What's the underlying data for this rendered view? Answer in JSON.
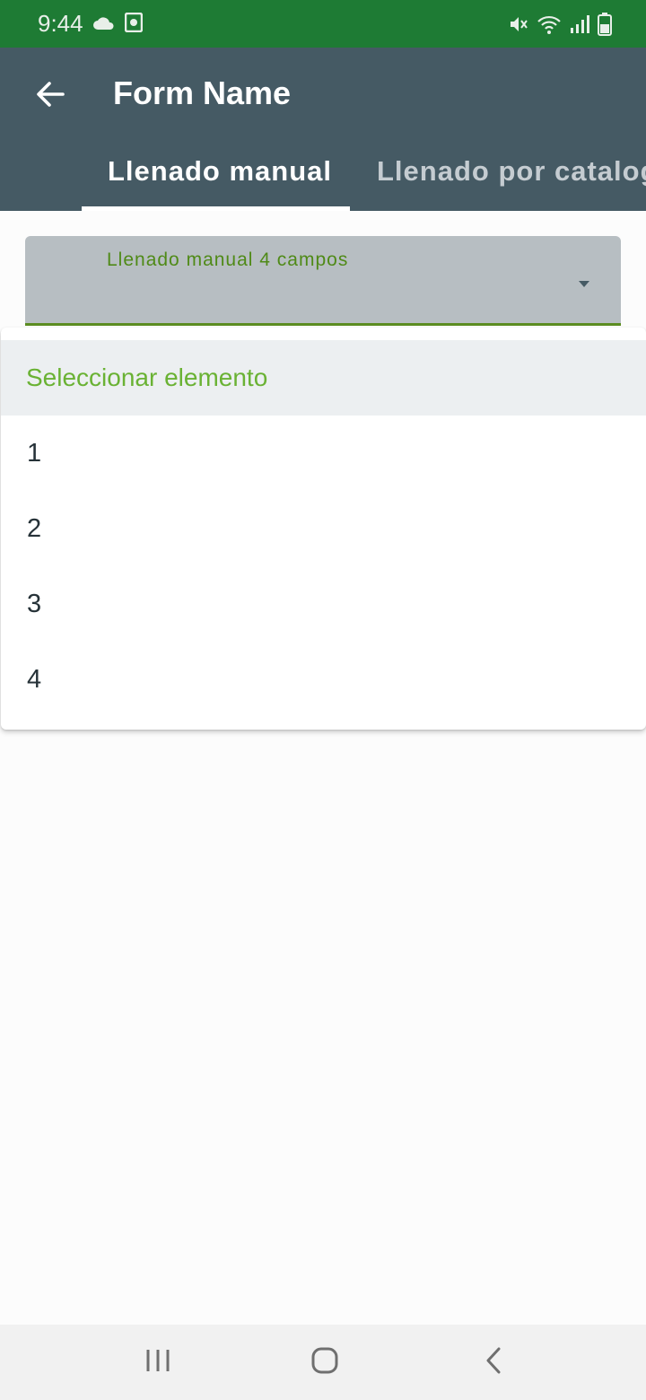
{
  "status_bar": {
    "time": "9:44",
    "left_icons": [
      "cloud-icon",
      "screenshot-icon"
    ],
    "right_icons": [
      "mute-icon",
      "wifi-icon",
      "signal-icon",
      "battery-icon"
    ]
  },
  "app_bar": {
    "title": "Form Name",
    "back_icon": "arrow-left-icon",
    "tabs": [
      {
        "label": "Llenado manual",
        "selected": true
      },
      {
        "label": "Llenado por catalogo",
        "selected": false
      }
    ],
    "color": "#455a64"
  },
  "select": {
    "label": "Llenado manual 4 campos",
    "accent": "#5b8c21"
  },
  "dropdown": {
    "header": "Seleccionar elemento",
    "options": [
      "1",
      "2",
      "3",
      "4"
    ]
  },
  "nav_bar": {
    "buttons": [
      "recents-icon",
      "home-icon",
      "back-icon"
    ]
  },
  "colors": {
    "status_bar": "#1e7b34",
    "header_text": "#6ab234"
  }
}
